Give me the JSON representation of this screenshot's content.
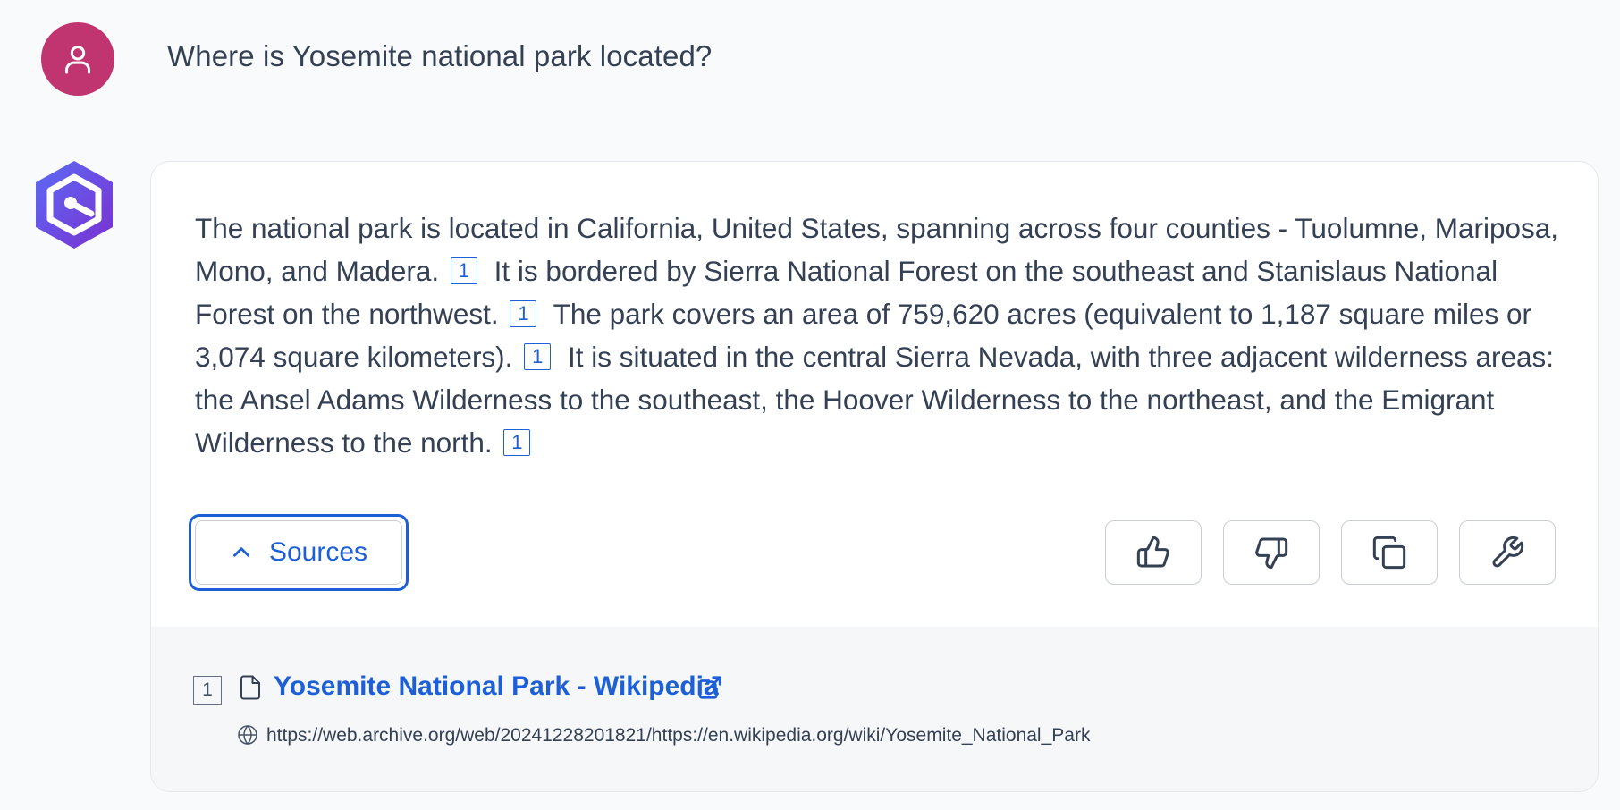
{
  "user": {
    "avatar_icon": "user-icon",
    "avatar_color": "#c0356f",
    "question": "Where is Yosemite national park located?"
  },
  "assistant": {
    "logo_icon": "hexagon-logo-icon",
    "answer": [
      {
        "text": "The national park is located in California, United States, spanning across four counties - Tuolumne, Mariposa, Mono, and Madera. ",
        "cite": "1"
      },
      {
        "text": " It is bordered by Sierra National Forest on the southeast and Stanislaus National Forest on the northwest. ",
        "cite": "1"
      },
      {
        "text": " The park covers an area of 759,620 acres (equivalent to 1,187 square miles or 3,074 square kilometers). ",
        "cite": "1"
      },
      {
        "text": " It is situated in the central Sierra Nevada, with three adjacent wilderness areas: the Ansel Adams Wilderness to the southeast, the Hoover Wilderness to the northeast, and the Emigrant Wilderness to the north. ",
        "cite": "1"
      }
    ],
    "sources_button": {
      "label": "Sources",
      "icon": "chevron-up-icon"
    },
    "actions": [
      {
        "name": "thumbs-up-button",
        "icon": "thumbs-up-icon"
      },
      {
        "name": "thumbs-down-button",
        "icon": "thumbs-down-icon"
      },
      {
        "name": "copy-button",
        "icon": "copy-icon"
      },
      {
        "name": "wrench-button",
        "icon": "wrench-icon"
      }
    ],
    "sources": [
      {
        "number": "1",
        "title": "Yosemite National Park - Wikipedia",
        "url": "https://web.archive.org/web/20241228201821/https://en.wikipedia.org/wiki/Yosemite_National_Park"
      }
    ]
  },
  "colors": {
    "accent": "#1d5fd6",
    "text": "#344054",
    "background": "#f9fafb"
  }
}
